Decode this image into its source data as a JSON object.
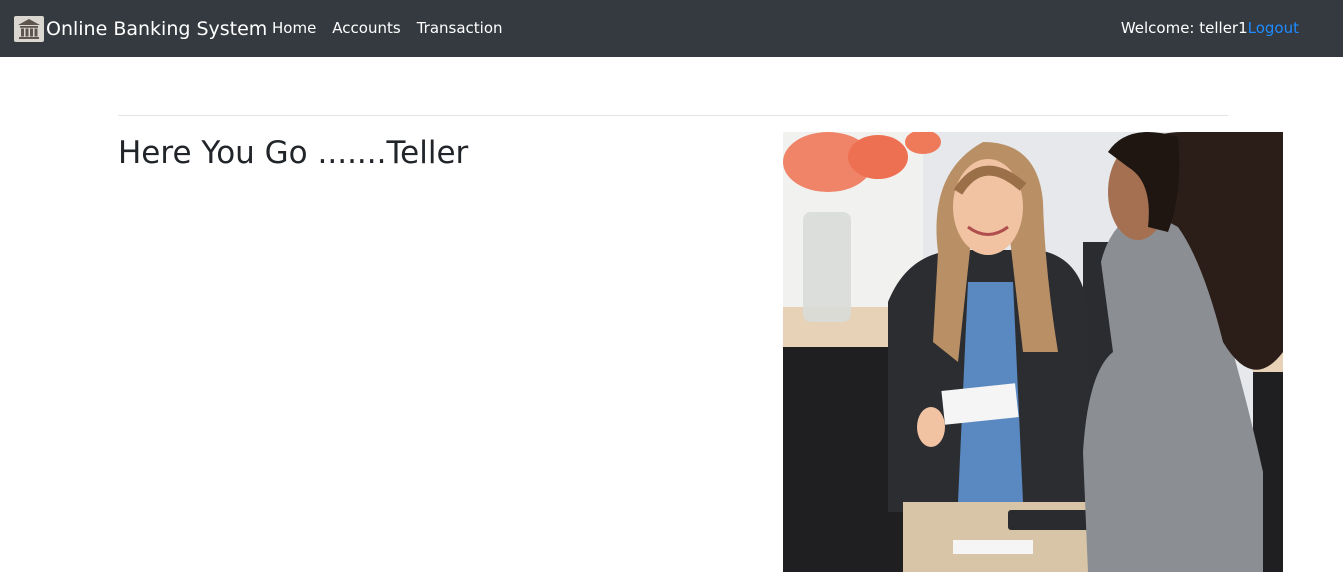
{
  "navbar": {
    "brand": "Online Banking System",
    "links": [
      "Home",
      "Accounts",
      "Transaction"
    ],
    "welcome": "Welcome: teller1",
    "logout": "Logout"
  },
  "main": {
    "heading": "Here You Go .......Teller"
  },
  "icons": {
    "logo": "bank-building-icon"
  },
  "colors": {
    "navbar_bg": "#343a40",
    "link": "#1e8bff"
  }
}
